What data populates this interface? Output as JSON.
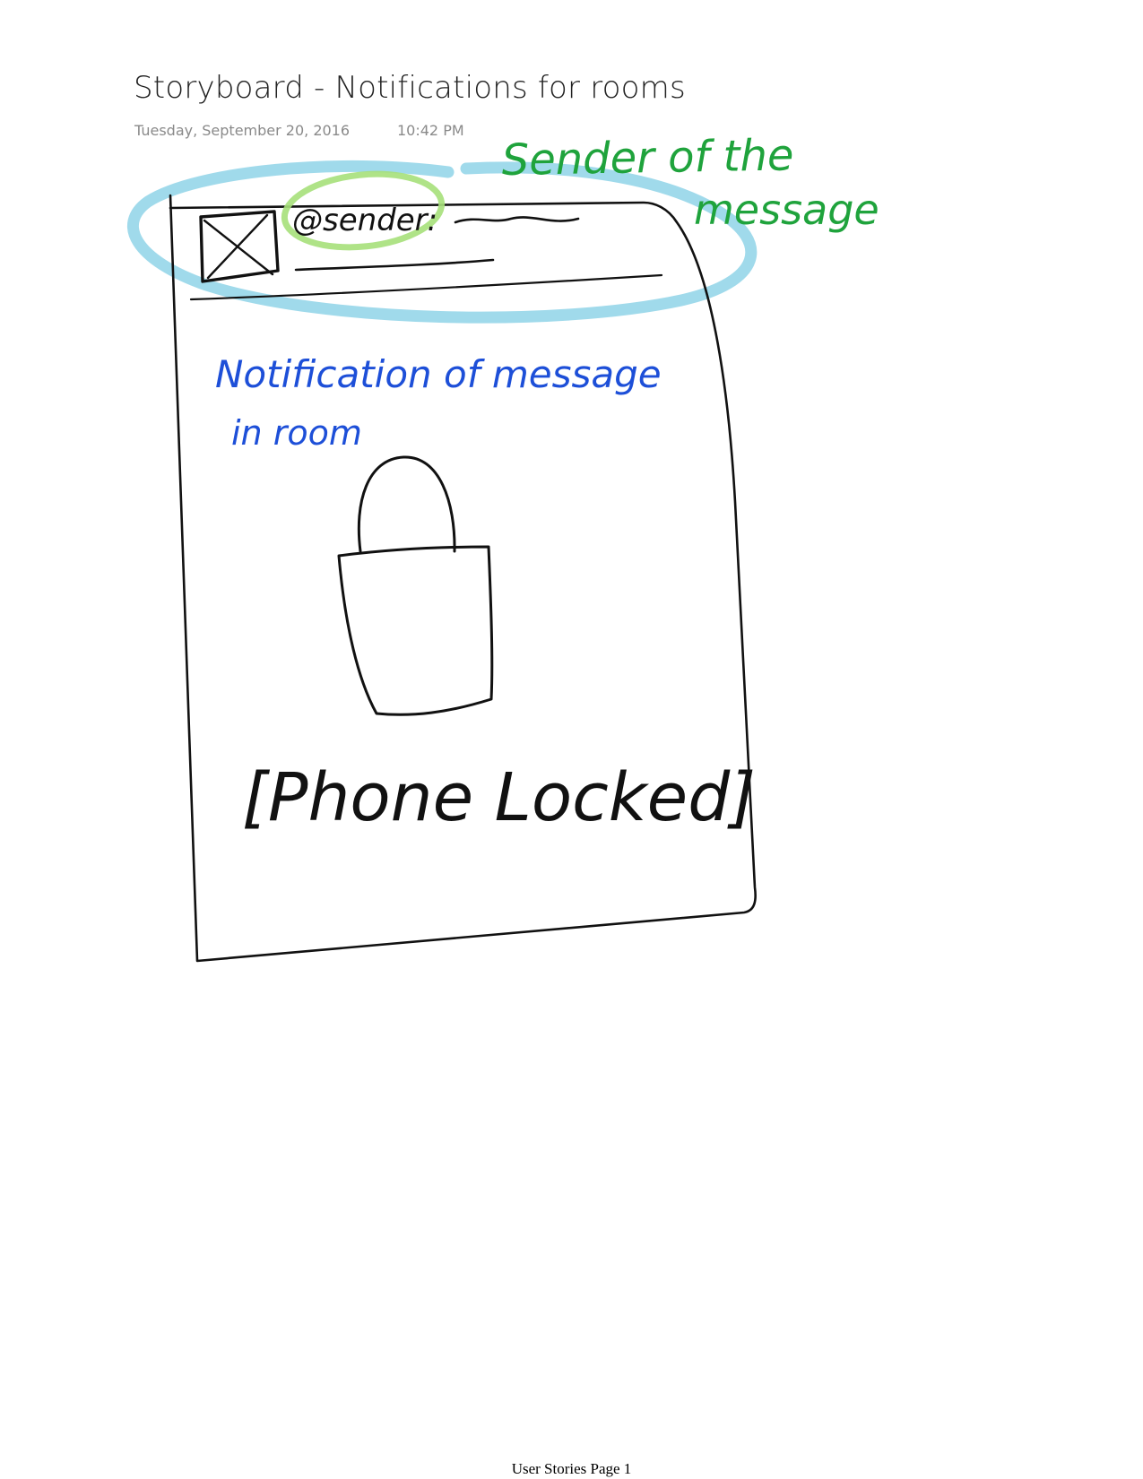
{
  "page": {
    "title": "Storyboard - Notifications for rooms",
    "date": "Tuesday, September 20, 2016",
    "time": "10:42 PM",
    "footer": "User Stories Page 1"
  },
  "sketch": {
    "sender_handle": "@sender:",
    "annotation_sender": {
      "line1": "Sender of the",
      "line2": "message"
    },
    "annotation_notification": {
      "line1": "Notification of message",
      "line2": "in room"
    },
    "lock_label": "[Phone Locked]",
    "colors": {
      "ink_black": "#111111",
      "highlight_cyan": "#8fd3e8",
      "highlight_green": "#a6e07a",
      "ink_green": "#1fa33c",
      "ink_blue": "#1d4fd8"
    },
    "icons": [
      "image-placeholder-icon",
      "padlock-icon"
    ]
  }
}
